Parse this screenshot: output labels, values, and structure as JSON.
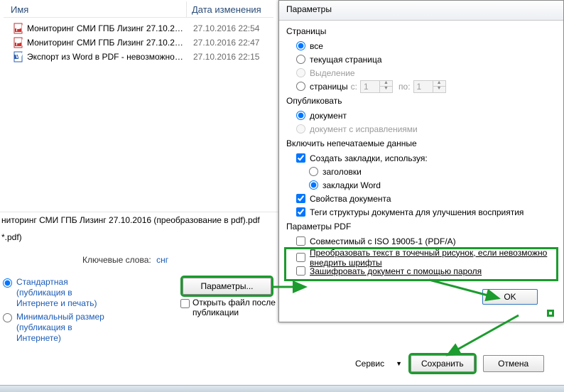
{
  "columns": {
    "name": "Имя",
    "date": "Дата изменения"
  },
  "files": [
    {
      "icon": "pdf",
      "name": "Мониторинг СМИ ГПБ Лизинг 27.10.20...",
      "date": "27.10.2016 22:54"
    },
    {
      "icon": "pdf",
      "name": "Мониторинг СМИ ГПБ Лизинг 27.10.20...",
      "date": "27.10.2016 22:47"
    },
    {
      "icon": "word",
      "name": "Экспорт из Word в PDF - невозможност...",
      "date": "27.10.2016 22:15"
    }
  ],
  "saveName": "ниторинг СМИ ГПБ Лизинг 27.10.2016 (преобразование в pdf).pdf",
  "filter": "*.pdf)",
  "keywords": {
    "label": "Ключевые слова:",
    "value": "снг"
  },
  "optimize": {
    "opt1": "Стандартная (публикация в Интернете и печать)",
    "opt2": "Минимальный размер (публикация в Интернете)"
  },
  "paramsBtn": "Параметры...",
  "openAfter": "Открыть файл после публикации",
  "tools": "Сервис",
  "saveBtn": "Сохранить",
  "cancelBtn": "Отмена",
  "paramsDialog": {
    "title": "Параметры",
    "pages": {
      "group": "Страницы",
      "all": "все",
      "current": "текущая страница",
      "selection": "Выделение",
      "range": "страницы",
      "from": "с:",
      "to": "по:",
      "fromVal": "1",
      "toVal": "1"
    },
    "publish": {
      "group": "Опубликовать",
      "doc": "документ",
      "withCorr": "документ с исправлениями"
    },
    "nonPrint": {
      "group": "Включить непечатаемые данные",
      "bookmarks": "Создать закладки, используя:",
      "headings": "заголовки",
      "wordBm": "закладки Word",
      "docProps": "Свойства документа",
      "tags": "Теги структуры документа для улучшения восприятия"
    },
    "pdfParams": {
      "group": "Параметры PDF",
      "iso": "Совместимый с ISO 19005-1 (PDF/A)",
      "bitmap": "Преобразовать текст в точечный рисунок, если невозможно внедрить шрифты",
      "encrypt": "Зашифровать документ с помощью пароля"
    },
    "ok": "OK"
  }
}
